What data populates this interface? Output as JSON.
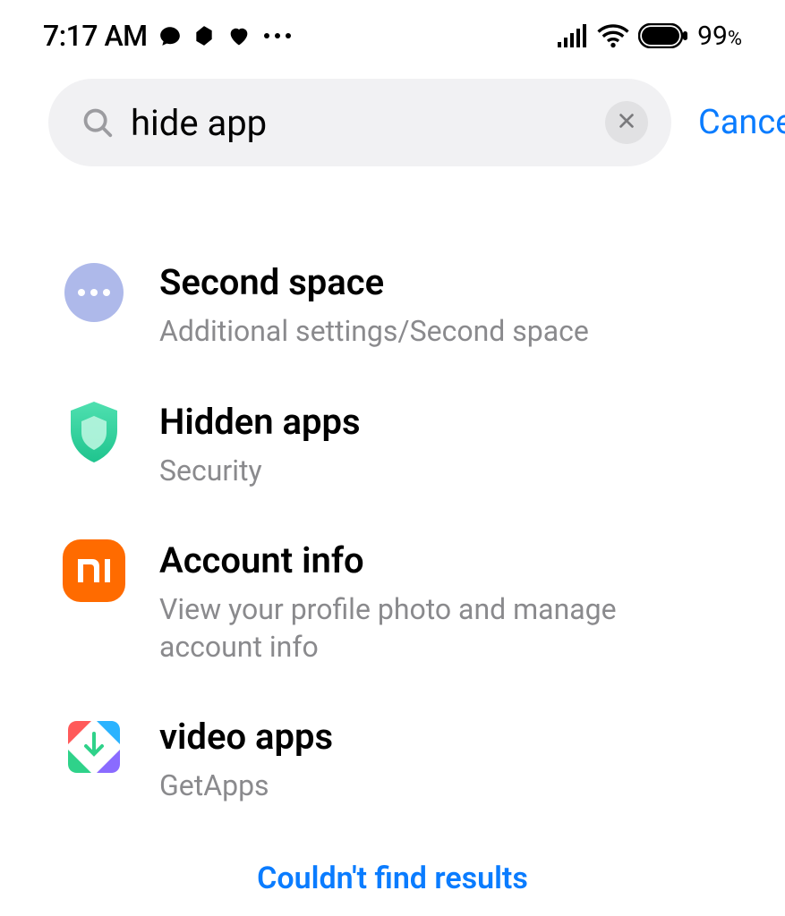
{
  "status": {
    "time": "7:17 AM",
    "battery": "99",
    "battery_pct_symbol": "%"
  },
  "search": {
    "value": "hide app",
    "cancel_label": "Cancel"
  },
  "results": [
    {
      "title": "Second space",
      "subtitle": "Additional settings/Second space"
    },
    {
      "title": "Hidden apps",
      "subtitle": "Security"
    },
    {
      "title": "Account info",
      "subtitle": "View your profile photo and manage account info"
    },
    {
      "title": "video apps",
      "subtitle": "GetApps"
    }
  ],
  "footer": {
    "no_results_label": "Couldn't find results"
  }
}
